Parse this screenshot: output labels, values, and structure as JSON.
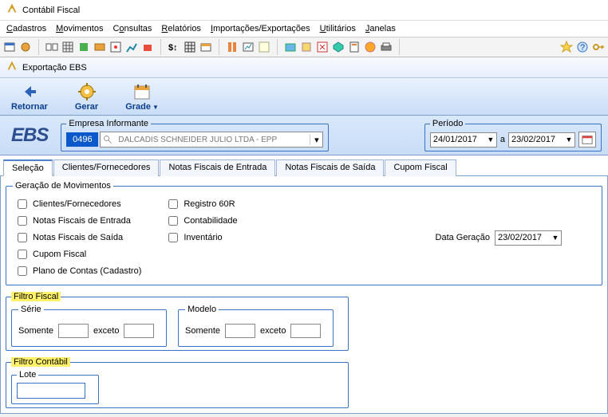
{
  "app_title": "Contábil Fiscal",
  "menubar": [
    "Cadastros",
    "Movimentos",
    "Consultas",
    "Relatórios",
    "Importações/Exportações",
    "Utilitários",
    "Janelas"
  ],
  "window_title": "Exportação EBS",
  "ribbon": {
    "retornar": "Retornar",
    "gerar": "Gerar",
    "grade": "Grade"
  },
  "logo_text": "EBS",
  "empresa": {
    "legend": "Empresa Informante",
    "code": "0496",
    "name": "DALCADIS SCHNEIDER JULIO LTDA - EPP"
  },
  "periodo": {
    "legend": "Período",
    "from": "24/01/2017",
    "sep": "a",
    "to": "23/02/2017"
  },
  "tabs": [
    "Seleção",
    "Clientes/Fornecedores",
    "Notas Fiscais de Entrada",
    "Notas Fiscais de Saída",
    "Cupom Fiscal"
  ],
  "geracao": {
    "legend": "Geração de Movimentos",
    "col1": [
      "Clientes/Fornecedores",
      "Notas Fiscais de Entrada",
      "Notas Fiscais de Saída",
      "Cupom Fiscal",
      "Plano de Contas (Cadastro)"
    ],
    "col2": [
      "Registro 60R",
      "Contabilidade",
      "Inventário"
    ],
    "data_label": "Data Geração",
    "data_value": "23/02/2017"
  },
  "filtro_fiscal": {
    "legend": "Filtro Fiscal",
    "serie_legend": "Série",
    "modelo_legend": "Modelo",
    "somente": "Somente",
    "exceto": "exceto"
  },
  "filtro_contabil": {
    "legend": "Filtro Contábil",
    "lote_legend": "Lote"
  }
}
